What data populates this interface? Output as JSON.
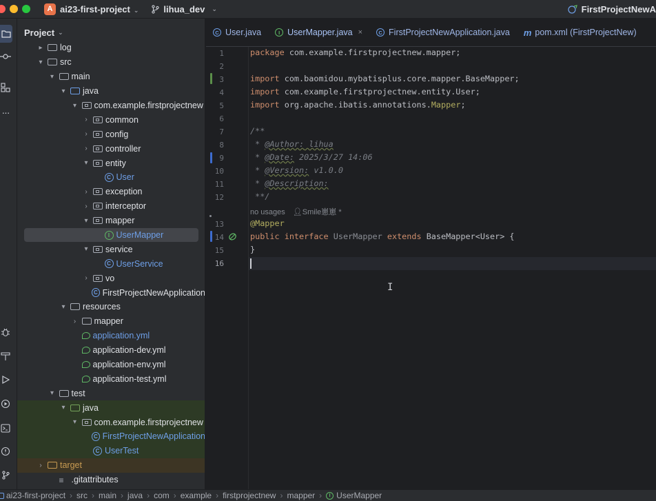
{
  "titlebar": {
    "project_badge": "A",
    "project_name": "ai23-first-project",
    "branch": "lihua_dev",
    "run_config": "FirstProjectNewA"
  },
  "panel": {
    "title": "Project"
  },
  "tree": [
    {
      "label": "log",
      "depth": 2,
      "icon": "folder",
      "arrow": "▸"
    },
    {
      "label": "src",
      "depth": 2,
      "icon": "folder",
      "arrow": "▾"
    },
    {
      "label": "main",
      "depth": 3,
      "icon": "folder",
      "arrow": "▾"
    },
    {
      "label": "java",
      "depth": 4,
      "icon": "folder-blue",
      "arrow": "▾"
    },
    {
      "label": "com.example.firstprojectnew",
      "depth": 5,
      "icon": "package",
      "arrow": "▾"
    },
    {
      "label": "common",
      "depth": 6,
      "icon": "package",
      "arrow": "›"
    },
    {
      "label": "config",
      "depth": 6,
      "icon": "package",
      "arrow": "›"
    },
    {
      "label": "controller",
      "depth": 6,
      "icon": "package",
      "arrow": "›"
    },
    {
      "label": "entity",
      "depth": 6,
      "icon": "package",
      "arrow": "▾"
    },
    {
      "label": "User",
      "depth": 7,
      "icon": "class",
      "arrow": ""
    },
    {
      "label": "exception",
      "depth": 6,
      "icon": "package",
      "arrow": "›"
    },
    {
      "label": "interceptor",
      "depth": 6,
      "icon": "package",
      "arrow": "›"
    },
    {
      "label": "mapper",
      "depth": 6,
      "icon": "package",
      "arrow": "▾"
    },
    {
      "label": "UserMapper",
      "depth": 7,
      "icon": "interface",
      "arrow": "",
      "selected": true
    },
    {
      "label": "service",
      "depth": 6,
      "icon": "package",
      "arrow": "▾"
    },
    {
      "label": "UserService",
      "depth": 7,
      "icon": "class",
      "arrow": ""
    },
    {
      "label": "vo",
      "depth": 6,
      "icon": "package",
      "arrow": "›"
    },
    {
      "label": "FirstProjectNewApplication",
      "depth": 6,
      "icon": "class-run",
      "arrow": ""
    },
    {
      "label": "resources",
      "depth": 4,
      "icon": "folder-res",
      "arrow": "▾"
    },
    {
      "label": "mapper",
      "depth": 5,
      "icon": "folder",
      "arrow": "›"
    },
    {
      "label": "application.yml",
      "depth": 5,
      "icon": "yml",
      "arrow": "",
      "blue": true
    },
    {
      "label": "application-dev.yml",
      "depth": 5,
      "icon": "yml",
      "arrow": ""
    },
    {
      "label": "application-env.yml",
      "depth": 5,
      "icon": "yml",
      "arrow": ""
    },
    {
      "label": "application-test.yml",
      "depth": 5,
      "icon": "yml",
      "arrow": ""
    },
    {
      "label": "test",
      "depth": 3,
      "icon": "folder",
      "arrow": "▾"
    },
    {
      "label": "java",
      "depth": 4,
      "icon": "folder-green",
      "arrow": "▾",
      "test": true
    },
    {
      "label": "com.example.firstprojectnew",
      "depth": 5,
      "icon": "package",
      "arrow": "▾",
      "test": true
    },
    {
      "label": "FirstProjectNewApplication",
      "depth": 6,
      "icon": "class",
      "arrow": "",
      "test": true
    },
    {
      "label": "UserTest",
      "depth": 6,
      "icon": "class",
      "arrow": "",
      "test": true
    },
    {
      "label": "target",
      "depth": 2,
      "icon": "folder-orange",
      "arrow": "›",
      "target": true
    },
    {
      "label": ".gitattributes",
      "depth": 3,
      "icon": "file",
      "arrow": ""
    }
  ],
  "tabs": [
    {
      "label": "User.java",
      "icon": "C"
    },
    {
      "label": "UserMapper.java",
      "icon": "I",
      "active": true,
      "close": "×"
    },
    {
      "label": "FirstProjectNewApplication.java",
      "icon": "C"
    },
    {
      "label": "pom.xml (FirstProjectNew)",
      "icon": "m"
    }
  ],
  "editor": {
    "line_numbers": [
      "1",
      "2",
      "3",
      "4",
      "5",
      "6",
      "7",
      "8",
      "9",
      "10",
      "11",
      "12",
      "13",
      "14",
      "15",
      "16"
    ],
    "usage_hint": "no usages",
    "author_hint": "Smile崽崽 *",
    "lines": {
      "l1_kw": "package",
      "l1_rest": " com.example.firstprojectnew.mapper;",
      "l3_kw": "import",
      "l3_rest": " com.baomidou.mybatisplus.core.mapper.BaseMapper;",
      "l4_kw": "import",
      "l4_rest": " com.example.firstprojectnew.entity.User;",
      "l5_kw": "import",
      "l5_rest": " org.apache.ibatis.annotations.",
      "l5_ann": "Mapper",
      "l5_end": ";",
      "l7": "/**",
      "l8_pre": " * ",
      "l8_tag": "@Author:",
      "l8_val": " lihua",
      "l9_pre": " * ",
      "l9_tag": "@Date:",
      "l9_val": " 2025/3/27 14:06",
      "l10_pre": " * ",
      "l10_tag": "@Version:",
      "l10_val": " v1.0.0",
      "l11_pre": " * ",
      "l11_tag": "@Description:",
      "l12": " **/",
      "l13": "@Mapper",
      "l14_kw1": "public interface",
      "l14_name": " UserMapper ",
      "l14_kw2": "extends",
      "l14_rest": " BaseMapper<User> {",
      "l15": "}"
    }
  },
  "statusbar": {
    "crumbs": [
      "ai23-first-project",
      "src",
      "main",
      "java",
      "com",
      "example",
      "firstprojectnew",
      "mapper",
      "UserMapper"
    ],
    "separator": "›"
  }
}
